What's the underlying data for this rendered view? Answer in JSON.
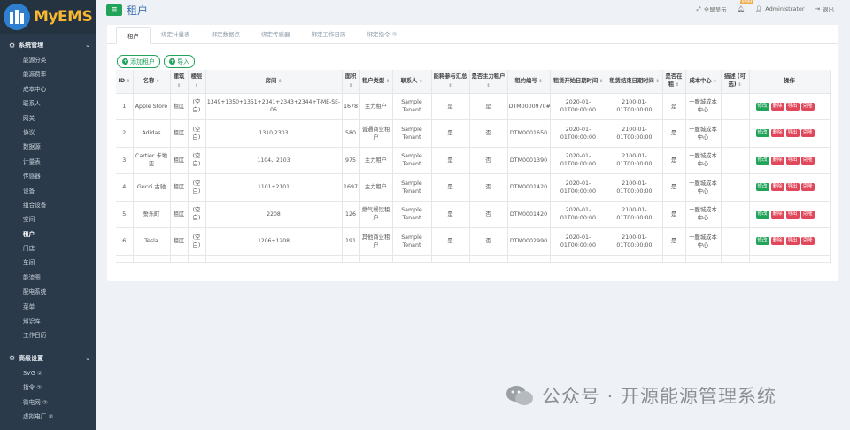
{
  "app": {
    "name": "MyEMS",
    "page_title": "租户"
  },
  "topbar": {
    "fullscreen": "全屏显示",
    "badge": "9999",
    "user": "Administrator",
    "logout": "退出"
  },
  "sidebar": {
    "system_section": "系统管理",
    "system_items": [
      "能源分类",
      "能源费率",
      "成本中心",
      "联系人",
      "网关",
      "协议",
      "数据源",
      "计量表",
      "传感器",
      "设备",
      "组合设备",
      "空间",
      "租户",
      "门店",
      "车间",
      "能流图",
      "配电系统",
      "菜单",
      "知识库",
      "工作日历"
    ],
    "active_item": "租户",
    "advanced_section": "高级设置",
    "advanced_items": [
      "SVG ②",
      "指令 ②",
      "微电网 ②",
      "虚拟电厂 ②"
    ]
  },
  "tabs": [
    "租户",
    "绑定计量表",
    "绑定数据点",
    "绑定传感器",
    "绑定工作日历",
    "绑定指令 ②"
  ],
  "buttons": {
    "add": "添加租户",
    "import": "导入"
  },
  "table": {
    "headers": [
      "ID",
      "名称",
      "建筑",
      "楼层",
      "房间",
      "面积",
      "租户类型",
      "联系人",
      "能耗参与汇总",
      "是否主力租户",
      "租约编号",
      "租赁开始日期时间",
      "租赁结束日期时间",
      "是否在租",
      "成本中心",
      "描述 (可选)",
      "操作"
    ],
    "row_actions": {
      "edit": "修改",
      "delete": "删除",
      "export": "导出",
      "clone": "克隆"
    },
    "rows": [
      [
        "1",
        "Apple Store",
        "租区",
        "(空白)",
        "1349+1350+1351+2341+2343+2344+T-ME-SE-06",
        "1678",
        "主力租户",
        "Sample Tenant",
        "是",
        "是",
        "DTM0000970#",
        "2020-01-01T00:00:00",
        "2100-01-01T00:00:00",
        "是",
        "一腹城成本中心",
        ""
      ],
      [
        "2",
        "Adidas",
        "租区",
        "(空白)",
        "1310,2303",
        "580",
        "普通商业租户",
        "Sample Tenant",
        "是",
        "否",
        "DTM0001650",
        "2020-01-01T00:00:00",
        "2100-01-01T00:00:00",
        "是",
        "一腹城成本中心",
        ""
      ],
      [
        "3",
        "Cartier 卡地亚",
        "租区",
        "(空白)",
        "1104、2103",
        "975",
        "主力租户",
        "Sample Tenant",
        "是",
        "否",
        "DTM0001390",
        "2020-01-01T00:00:00",
        "2100-01-01T00:00:00",
        "是",
        "一腹城成本中心",
        ""
      ],
      [
        "4",
        "Gucci 古驰",
        "租区",
        "(空白)",
        "1101+2101",
        "1697",
        "主力租户",
        "Sample Tenant",
        "是",
        "否",
        "DTM0001420",
        "2020-01-01T00:00:00",
        "2100-01-01T00:00:00",
        "是",
        "一腹城成本中心",
        ""
      ],
      [
        "5",
        "誓乐町",
        "租区",
        "(空白)",
        "2208",
        "126",
        "燃气餐饮租户",
        "Sample Tenant",
        "是",
        "否",
        "DTM0001420",
        "2020-01-01T00:00:00",
        "2100-01-01T00:00:00",
        "是",
        "一腹城成本中心",
        ""
      ],
      [
        "6",
        "Tesla",
        "租区",
        "(空白)",
        "1206+1208",
        "191",
        "其他商业租户",
        "Sample Tenant",
        "是",
        "否",
        "DTM0002990",
        "2020-01-01T00:00:00",
        "2100-01-01T00:00:00",
        "是",
        "一腹城成本中心",
        ""
      ]
    ]
  },
  "watermark": "公众号 · 开源能源管理系统",
  "colors": {
    "sidebar": "#2b3a4a",
    "accent": "#22a35a",
    "danger": "#e0475a",
    "logo": "#f7b731",
    "title": "#3a6fb0"
  }
}
